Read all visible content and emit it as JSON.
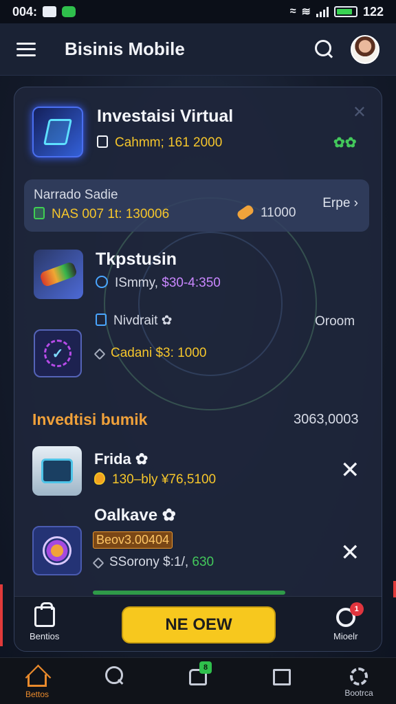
{
  "status_bar": {
    "time": "004:",
    "clock": "122"
  },
  "app_bar": {
    "title": "Bisinis Mobile"
  },
  "card": {
    "item1": {
      "title": "Investaisi Virtual",
      "value": "Cahmm; 161 2000",
      "tag": "✿✿"
    },
    "panel": {
      "label": "Narrado Sadie",
      "code": "NAS 007 1t: 130006",
      "count": "11000",
      "expand_label": "Erpe ›"
    },
    "item2": {
      "title": "Tkpstusin",
      "detail": "ISmmy, ",
      "amount": "$30-4:350"
    },
    "item3": {
      "title": "Nivdrait ✿",
      "side_label": "Oroom",
      "detail": "Cadani $3: 1000"
    },
    "section": {
      "title": "Invedtisi bumik",
      "total": "3063,0003"
    },
    "item4": {
      "title": "Frida ✿",
      "detail": "130–bly ¥76,5100"
    },
    "item5": {
      "title": "Oalkave ✿",
      "badge": "Beov3.00404",
      "detail_prefix": "SSorony $:1/,",
      "detail_amount": " 630"
    }
  },
  "dock": {
    "left_label": "Bentios",
    "button_label": "NE OEW",
    "right_label": "Mioelr",
    "notification_count": "1"
  },
  "bottom_nav": {
    "items": [
      {
        "label": "Bettos"
      },
      {
        "label": ""
      },
      {
        "label": "",
        "badge": "8"
      },
      {
        "label": ""
      },
      {
        "label": "Bootrca"
      }
    ]
  },
  "colors": {
    "accent_yellow": "#f7c81e",
    "accent_orange": "#f0a13a",
    "accent_green": "#43c85b",
    "background": "#151c2c"
  },
  "icons": {
    "menu": "hamburger-icon",
    "search": "search-icon",
    "close": "close-icon",
    "home": "home-icon",
    "settings": "gear-icon"
  }
}
